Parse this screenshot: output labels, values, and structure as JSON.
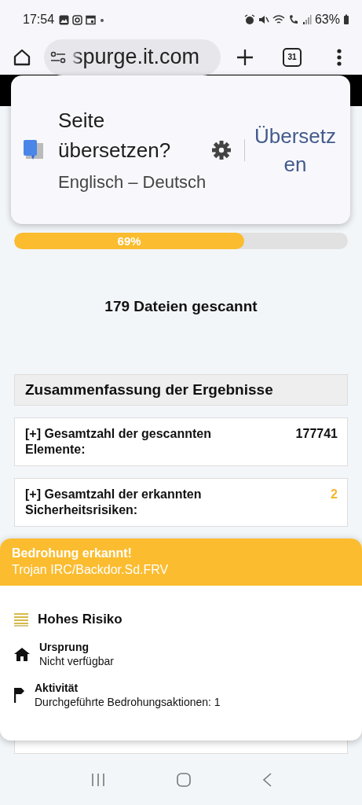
{
  "status_bar": {
    "time": "17:54",
    "battery": "63%"
  },
  "browser": {
    "url": "spurge.it.com",
    "tab_count": "31"
  },
  "translate_popup": {
    "title": "Seite übersetzen?",
    "languages": "Englisch – Deutsch",
    "action": "Übersetzen"
  },
  "scan": {
    "level": 0.69,
    "percent": "69%",
    "files": "179 Dateien gescannt"
  },
  "summary": {
    "title": "Zusammenfassung der Ergebnisse",
    "rows": [
      {
        "label": "[+] Gesamtzahl der gescannten Elemente:",
        "value": "177741",
        "highlight": false
      },
      {
        "label": "[+] Gesamtzahl der erkannten Sicherheitsrisiken:",
        "value": "2",
        "highlight": true
      }
    ]
  },
  "threat": {
    "title": "Bedrohung erkannt!",
    "name": "Trojan IRC/Backdor.Sd.FRV",
    "risk": "Hohes Risiko",
    "details": [
      {
        "kind": "origin",
        "label": "Ursprung",
        "value": "Nicht verfügbar"
      },
      {
        "kind": "activity",
        "label": "Aktivität",
        "value": "Durchgeführte Bedrohungsaktionen: 1"
      }
    ]
  }
}
